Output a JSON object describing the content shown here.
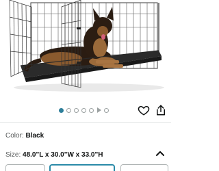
{
  "product_image": {
    "subject": "german-shepherd-in-wire-crate"
  },
  "carousel": {
    "dot_count": 6,
    "active_index": 0,
    "has_video_indicator": true
  },
  "icons": {
    "favorite": "heart-icon",
    "share": "share-icon",
    "expand": "chevron-up-icon"
  },
  "colors": {
    "accent": "#2e7f9a",
    "text": "#0f1111",
    "muted": "#565959",
    "selected_border": "#2a8aa8"
  },
  "color_selector": {
    "label": "Color:",
    "value": "Black"
  },
  "size_selector": {
    "label": "Size:",
    "value": "48.0\"L x 30.0\"W x 33.0\"H"
  }
}
